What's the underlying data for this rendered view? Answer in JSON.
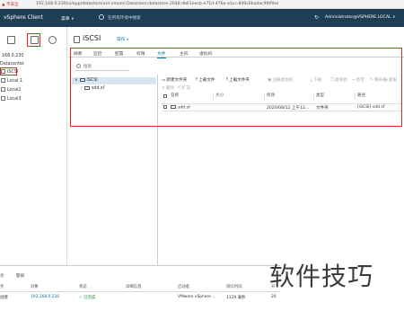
{
  "browser": {
    "security": "▲ 不安全",
    "url": "192.168.0.230/ui/app/datastore/urn:vmomi:Datastore:datastore-2048:db61eecb-e71d-476e-a1cc-849c6badac99/files"
  },
  "header": {
    "brand": "vSphere Client",
    "menu_label": "菜单 ∨",
    "search_placeholder": "在所有环境中搜索",
    "refresh_icon": "↻",
    "user": "Administrator@VSPHERE.LOCAL ∨"
  },
  "leftnav": {
    "host_label": "168.0.230",
    "datacenter": "Datacenter",
    "items": [
      "iSCSI",
      "Local 1",
      "Local2",
      "Local3"
    ]
  },
  "main": {
    "title": "iSCSI",
    "actions": "操作 ∨",
    "tabs": [
      "摘要",
      "监控",
      "配置",
      "权限",
      "文件",
      "主机",
      "虚拟机"
    ],
    "active_tab": "文件",
    "search_placeholder": "搜索",
    "tree": {
      "root": "iSCSI",
      "child": "sdd.sf"
    },
    "toolbar": {
      "new_folder": "新建文件夹",
      "upload_file": "上载文件",
      "upload_folder": "上载文件夹",
      "register_vm": "注册虚拟机",
      "download": "下载",
      "copy_to": "复制到",
      "move_to": "移至",
      "rename": "重命名",
      "delete": "删除",
      "expand": "扩充",
      "inflate": "膨胀"
    },
    "table": {
      "headers": [
        "名称",
        "大小",
        "修改",
        "类型",
        "路径"
      ],
      "rows": [
        {
          "name": "sdd.sf",
          "size": "",
          "modified": "2020/08/12 上午12...",
          "type": "文件夹",
          "path": "[iSCSI] sdd.sf"
        }
      ]
    }
  },
  "bottom": {
    "tabs": [
      "务",
      "警报"
    ],
    "headers": [
      "务",
      "对象",
      "状态",
      "详细信息",
      "启动者",
      "排队时间",
      "开"
    ],
    "row": {
      "task": "创建",
      "object": "192.168.0.230",
      "status": "✓ 已完成",
      "details": "",
      "initiator": "VMware vSphere ...",
      "queued": "1129 毫秒",
      "start": "20"
    }
  },
  "watermark": "软件技巧"
}
